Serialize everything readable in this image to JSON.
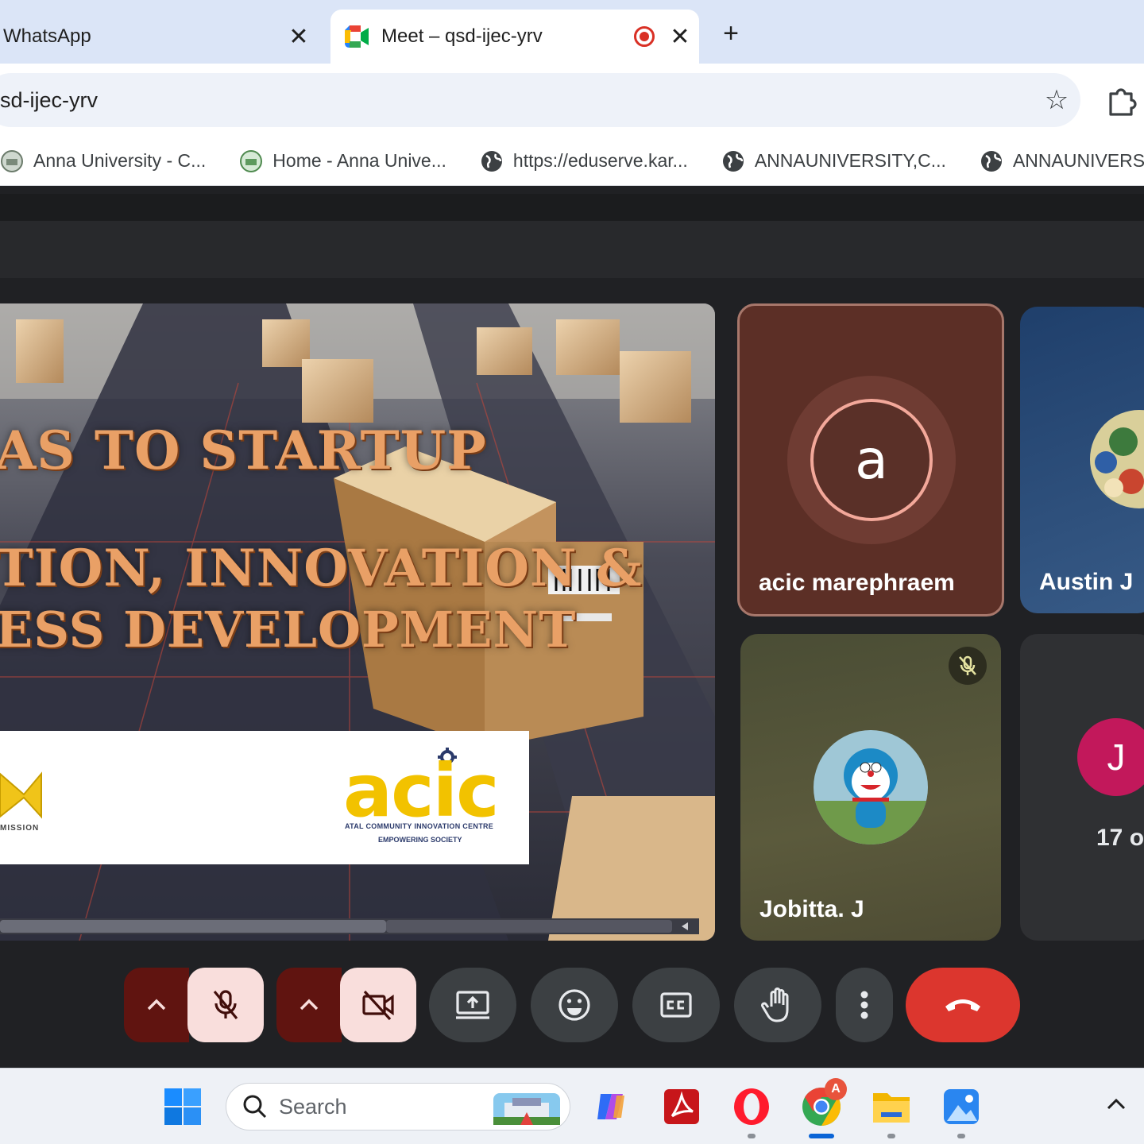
{
  "browser": {
    "tabs": [
      {
        "title": "WhatsApp",
        "active": false
      },
      {
        "title": "Meet – qsd-ijec-yrv",
        "active": true,
        "recording": true
      }
    ],
    "new_tab_symbol": "+",
    "close_symbol": "✕",
    "url": "sd-ijec-yrv",
    "star_symbol": "☆",
    "bookmarks": [
      {
        "label": "Anna University - C...",
        "icon": "university-seal-icon"
      },
      {
        "label": "Home - Anna Unive...",
        "icon": "university-seal-icon"
      },
      {
        "label": "https://eduserve.kar...",
        "icon": "globe-icon"
      },
      {
        "label": "ANNAUNIVERSITY,C...",
        "icon": "globe-icon"
      },
      {
        "label": "ANNAUNIVERSI",
        "icon": "globe-icon"
      }
    ]
  },
  "meet": {
    "presentation": {
      "line1": "AS TO STARTUP",
      "line2": "TION, INNOVATION &",
      "line3": "ESS DEVELOPMENT",
      "mission_text": "MISSION",
      "acic_logo": "acic",
      "acic_line1": "ATAL COMMUNITY INNOVATION CENTRE",
      "acic_line2": "EMPOWERING SOCIETY"
    },
    "participants": [
      {
        "name": "acic marephraem",
        "avatar_letter": "a",
        "speaking": true
      },
      {
        "name": "Austin J",
        "avatar": "photo"
      },
      {
        "name": "Jobitta. J",
        "avatar": "cartoon-photo",
        "muted": true
      },
      {
        "avatar_letter": "J",
        "others_text": "17 o"
      }
    ],
    "controls": [
      {
        "name": "mic-options",
        "icon": "chevron-up-icon"
      },
      {
        "name": "microphone",
        "icon": "mic-off-icon",
        "state": "off"
      },
      {
        "name": "camera-options",
        "icon": "chevron-up-icon"
      },
      {
        "name": "camera",
        "icon": "camera-off-icon",
        "state": "off"
      },
      {
        "name": "present",
        "icon": "present-screen-icon"
      },
      {
        "name": "reactions",
        "icon": "emoji-icon"
      },
      {
        "name": "captions",
        "icon": "captions-icon"
      },
      {
        "name": "raise-hand",
        "icon": "hand-icon"
      },
      {
        "name": "more-options",
        "icon": "more-vert-icon"
      },
      {
        "name": "leave-call",
        "icon": "call-end-icon"
      }
    ],
    "colors": {
      "end_call": "#dc362e",
      "muted_bg": "#f9dedc",
      "muted_group": "#601410",
      "avatar_j": "#c2185b"
    }
  },
  "taskbar": {
    "search_placeholder": "Search",
    "apps": [
      "windows-start-icon",
      "copilot-icon",
      "acrobat-icon",
      "opera-icon",
      "chrome-icon",
      "file-explorer-icon",
      "photos-icon"
    ],
    "chrome_badge": "A"
  }
}
